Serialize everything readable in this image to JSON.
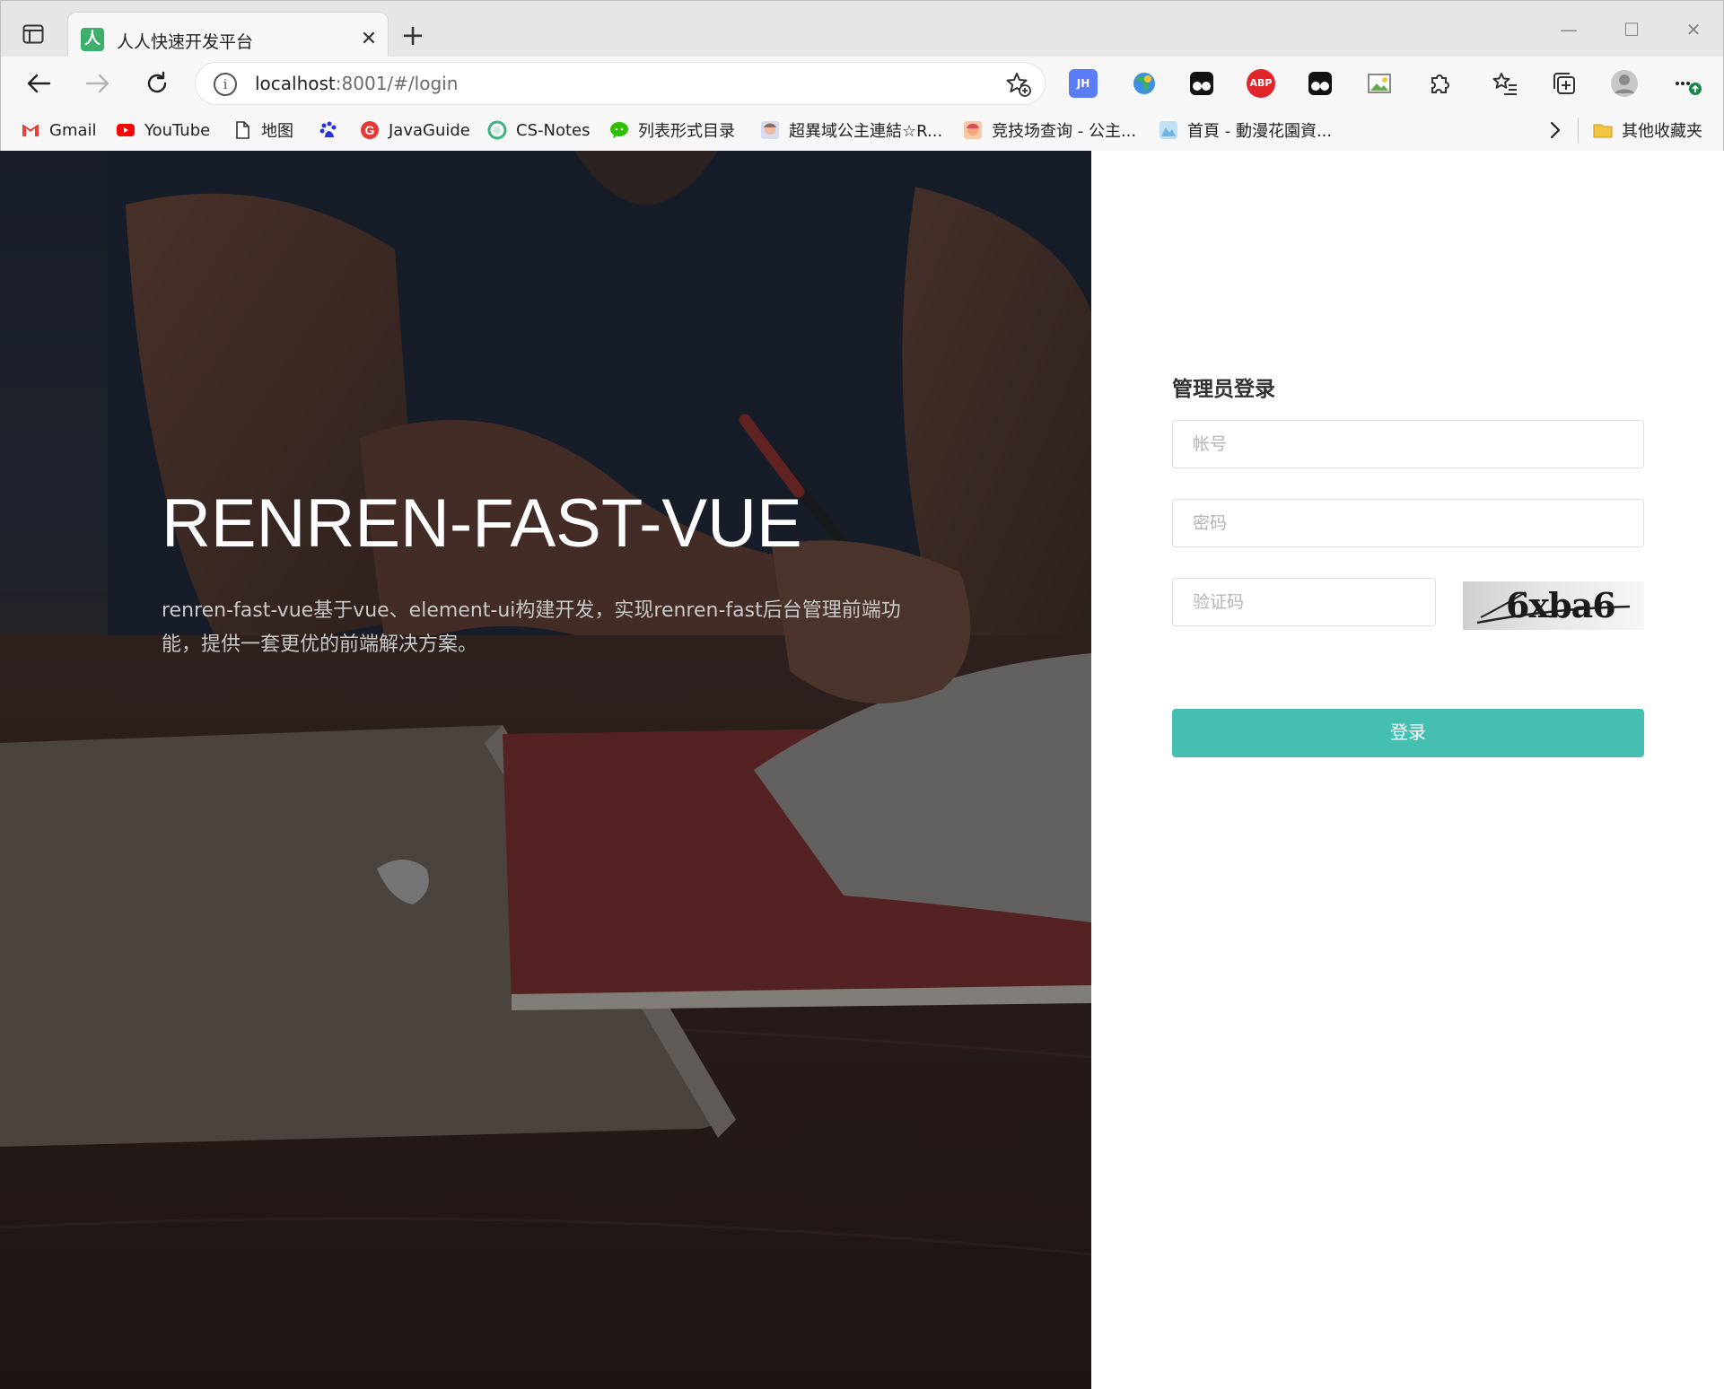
{
  "browser": {
    "tab_title": "人人快速开发平台",
    "tab_favicon_char": "人",
    "url_host": "localhost",
    "url_rest": ":8001/#/login",
    "extensions": [
      {
        "name": "jh-extension-icon",
        "label": "JH",
        "color": "#5b7cf5"
      },
      {
        "name": "abp-extension-icon",
        "label": "ABP",
        "color": "#e0262b"
      }
    ]
  },
  "bookmarks": [
    {
      "label": "Gmail",
      "icon": "gmail-icon",
      "color": "#ea4335"
    },
    {
      "label": "YouTube",
      "icon": "youtube-icon",
      "color": "#ff0000"
    },
    {
      "label": "地图",
      "icon": "page-icon",
      "color": "#ffffff"
    },
    {
      "label": "",
      "icon": "baidu-icon",
      "color": "#2932e1"
    },
    {
      "label": "JavaGuide",
      "icon": "javaguide-icon",
      "color": "#e53935"
    },
    {
      "label": "CS-Notes",
      "icon": "cs-notes-icon",
      "color": "#3fb27f"
    },
    {
      "label": "列表形式目录",
      "icon": "wechat-icon",
      "color": "#2dc100"
    },
    {
      "label": "超異域公主連結☆R...",
      "icon": "princess-connect-icon",
      "color": "#8c9bd1"
    },
    {
      "label": "竞技场查询 - 公主...",
      "icon": "arena-query-icon",
      "color": "#e57373"
    },
    {
      "label": "首頁 - 動漫花園資...",
      "icon": "dmhy-icon",
      "color": "#6fb3e0"
    }
  ],
  "bookmarks_other": "其他收藏夹",
  "hero": {
    "title": "RENREN-FAST-VUE",
    "description": "renren-fast-vue基于vue、element-ui构建开发，实现renren-fast后台管理前端功能，提供一套更优的前端解决方案。"
  },
  "login": {
    "title": "管理员登录",
    "username_placeholder": "帐号",
    "password_placeholder": "密码",
    "captcha_placeholder": "验证码",
    "captcha_text": "6xba6",
    "submit_label": "登录",
    "accent_color": "#45bfb2"
  }
}
